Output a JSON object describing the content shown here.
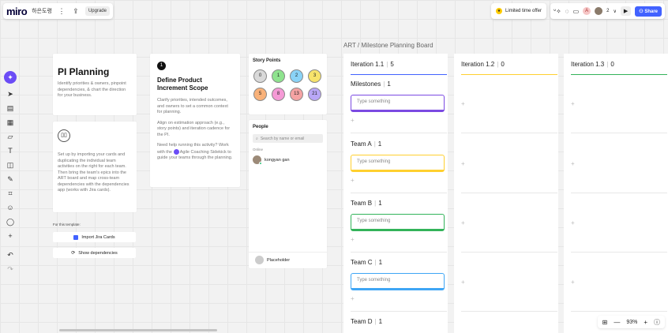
{
  "topbar": {
    "logo": "miro",
    "board_name": "하은도령",
    "upgrade_label": "Upgrade",
    "limited_offer": "Limited time offer",
    "reactions": "🎉",
    "user_initial": "A",
    "user_count": "2",
    "share_label": "Share"
  },
  "intro_card": {
    "title": "PI Planning",
    "description": "Identify priorities & owners, pinpoint dependencies, & chart the direction for your business."
  },
  "setup_card": {
    "text": "Set up by importing your cards and duplicating the individual team activities on the right for each team. Then bring the team's epics into the ART board and map cross-team dependencies with the dependencies app (works with Jira cards)."
  },
  "template": {
    "label": "For this template:",
    "import_label": "Import Jira Cards",
    "deps_label": "Show dependencies"
  },
  "step_card": {
    "number": "1",
    "title": "Define Product Increment Scope",
    "p1": "Clarify priorities, intended outcomes, and owners to set a common context for planning.",
    "p2": "Align on estimation approach (e.g., story points) and iteration cadence for the PI.",
    "p3a": "Need help running this activity? Work with the",
    "p3b": "Agile Coaching Sidekick to guide your teams through the planning."
  },
  "story_points": {
    "title": "Story Points",
    "items": [
      {
        "label": "0",
        "color": "#d9d9d9"
      },
      {
        "label": "1",
        "color": "#8ee38e"
      },
      {
        "label": "2",
        "color": "#8ad3f7"
      },
      {
        "label": "3",
        "color": "#f7e36b"
      },
      {
        "label": "5",
        "color": "#f9b27a"
      },
      {
        "label": "8",
        "color": "#f59ad6"
      },
      {
        "label": "13",
        "color": "#f5a3a3"
      },
      {
        "label": "21",
        "color": "#b9a7f7"
      }
    ]
  },
  "people": {
    "title": "People",
    "search_placeholder": "Search by name or email",
    "online_label": "Online",
    "person_name": "kongyan gan",
    "placeholder_label": "Placeholder"
  },
  "board": {
    "title": "ART / Milestone Planning Board",
    "columns": [
      {
        "name": "Iteration 1.1",
        "count": "5",
        "color": "#4262ff"
      },
      {
        "name": "Iteration 1.2",
        "count": "0",
        "color": "#ffd02f"
      },
      {
        "name": "Iteration 1.3",
        "count": "0",
        "color": "#33b35a"
      }
    ],
    "rows": [
      {
        "name": "Milestones",
        "count": "1",
        "color": "#7b4ae2"
      },
      {
        "name": "Team A",
        "count": "1",
        "color": "#ffd02f"
      },
      {
        "name": "Team B",
        "count": "1",
        "color": "#33b35a"
      },
      {
        "name": "Team C",
        "count": "1",
        "color": "#3fa6f5"
      },
      {
        "name": "Team D",
        "count": "1",
        "color": "#ff7a45"
      }
    ],
    "type_placeholder": "Type something",
    "plus": "+"
  },
  "zoom": {
    "level": "93%"
  }
}
